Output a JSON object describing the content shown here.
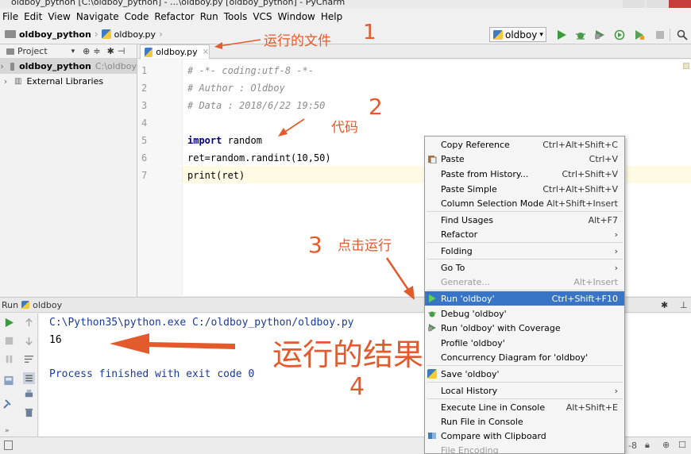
{
  "window": {
    "title": "oldboy_python [C:\\oldboy_python] - ...\\oldboy.py [oldboy_python] - PyCharm"
  },
  "menu": [
    "File",
    "Edit",
    "View",
    "Navigate",
    "Code",
    "Refactor",
    "Run",
    "Tools",
    "VCS",
    "Window",
    "Help"
  ],
  "breadcrumb": {
    "project": "oldboy_python",
    "file": "oldboy.py"
  },
  "run_config": "oldboy",
  "project_pane": {
    "header": "Project",
    "root": "oldboy_python",
    "root_path": "C:\\oldboy",
    "libs": "External Libraries"
  },
  "editor": {
    "tab": "oldboy.py",
    "lines": [
      {
        "num": "1",
        "text": "# -*- coding:utf-8 -*-"
      },
      {
        "num": "2",
        "text": "# Author : Oldboy"
      },
      {
        "num": "3",
        "text": "# Data : 2018/6/22 19:50"
      },
      {
        "num": "4",
        "text": ""
      },
      {
        "num": "5",
        "kw": "import",
        "text": " random"
      },
      {
        "num": "6",
        "text": "ret=random.randint(10,50)"
      },
      {
        "num": "7",
        "text": "print(ret)"
      }
    ]
  },
  "run_panel": {
    "label": "Run",
    "config": "oldboy",
    "cmd": "C:\\Python35\\python.exe C:/oldboy_python/oldboy.py",
    "output": "16",
    "exit": "Process finished with exit code 0"
  },
  "status": {
    "encoding_partial": "-8"
  },
  "context_menu": [
    {
      "label": "Copy Reference",
      "shortcut": "Ctrl+Alt+Shift+C"
    },
    {
      "label": "Paste",
      "shortcut": "Ctrl+V",
      "icon": "paste-icon"
    },
    {
      "label": "Paste from History...",
      "shortcut": "Ctrl+Shift+V"
    },
    {
      "label": "Paste Simple",
      "shortcut": "Ctrl+Alt+Shift+V"
    },
    {
      "label": "Column Selection Mode",
      "shortcut": "Alt+Shift+Insert"
    },
    {
      "label": "Find Usages",
      "shortcut": "Alt+F7"
    },
    {
      "label": "Refactor",
      "shortcut": "›"
    },
    {
      "label": "Folding",
      "shortcut": "›"
    },
    {
      "label": "Go To",
      "shortcut": "›"
    },
    {
      "label": "Generate...",
      "shortcut": "Alt+Insert",
      "disabled": true
    },
    {
      "label": "Run 'oldboy'",
      "shortcut": "Ctrl+Shift+F10",
      "selected": true
    },
    {
      "label": "Debug 'oldboy'",
      "shortcut": ""
    },
    {
      "label": "Run 'oldboy' with Coverage",
      "shortcut": ""
    },
    {
      "label": "Profile 'oldboy'",
      "shortcut": ""
    },
    {
      "label": "Concurrency Diagram for 'oldboy'",
      "shortcut": ""
    },
    {
      "label": "Save 'oldboy'",
      "shortcut": ""
    },
    {
      "label": "Local History",
      "shortcut": "›"
    },
    {
      "label": "Execute Line in Console",
      "shortcut": "Alt+Shift+E"
    },
    {
      "label": "Run File in Console",
      "shortcut": ""
    },
    {
      "label": "Compare with Clipboard",
      "shortcut": ""
    },
    {
      "label": "File Encoding",
      "shortcut": "",
      "disabled": true
    }
  ],
  "annotations": {
    "a1": "运行的文件",
    "n1": "1",
    "a2": "代码",
    "n2": "2",
    "a3": "点击运行",
    "n3": "3",
    "a4": "运行的结果",
    "n4": "4"
  },
  "colors": {
    "annotation": "#e35a2c",
    "selection": "#3875c6",
    "run_green": "#3c9a3c"
  }
}
